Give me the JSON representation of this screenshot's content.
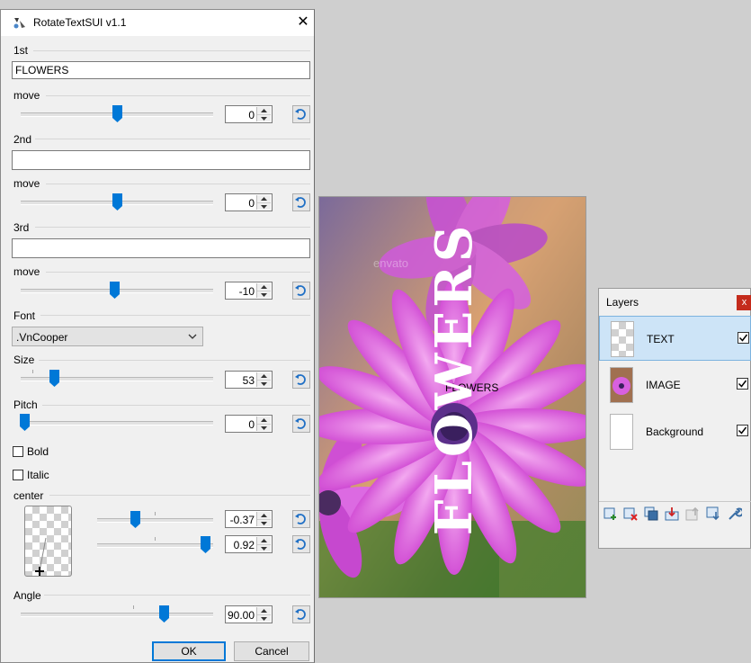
{
  "dialog": {
    "title": "RotateTextSUI v1.1",
    "close_glyph": "✕",
    "line1": {
      "label": "1st",
      "value": "FLOWERS",
      "move_label": "move",
      "move_value": "0"
    },
    "line2": {
      "label": "2nd",
      "value": "",
      "move_label": "move",
      "move_value": "0"
    },
    "line3": {
      "label": "3rd",
      "value": "",
      "move_label": "move",
      "move_value": "-10"
    },
    "font": {
      "label": "Font",
      "value": ".VnCooper"
    },
    "size": {
      "label": "Size",
      "value": "53"
    },
    "pitch": {
      "label": "Pitch",
      "value": "0"
    },
    "bold": {
      "label": "Bold",
      "checked": false
    },
    "italic": {
      "label": "Italic",
      "checked": false
    },
    "center": {
      "label": "center",
      "x_value": "-0.37",
      "y_value": "0.92"
    },
    "angle": {
      "label": "Angle",
      "value": "90.00"
    },
    "ok_label": "OK",
    "cancel_label": "Cancel"
  },
  "canvas": {
    "text": "FLOWERS",
    "watermark": "envato"
  },
  "layers": {
    "title": "Layers",
    "close_glyph": "x",
    "items": [
      {
        "name": "TEXT",
        "visible": true,
        "selected": true
      },
      {
        "name": "IMAGE",
        "visible": true,
        "selected": false
      },
      {
        "name": "Background",
        "visible": true,
        "selected": false
      }
    ],
    "toolbar_icons": [
      "add-layer-icon",
      "delete-layer-icon",
      "duplicate-layer-icon",
      "merge-down-icon",
      "move-up-icon",
      "move-down-icon",
      "properties-icon"
    ]
  },
  "colors": {
    "accent": "#0078d7",
    "selection": "#cde4f7",
    "flower": "#d94fd9"
  }
}
